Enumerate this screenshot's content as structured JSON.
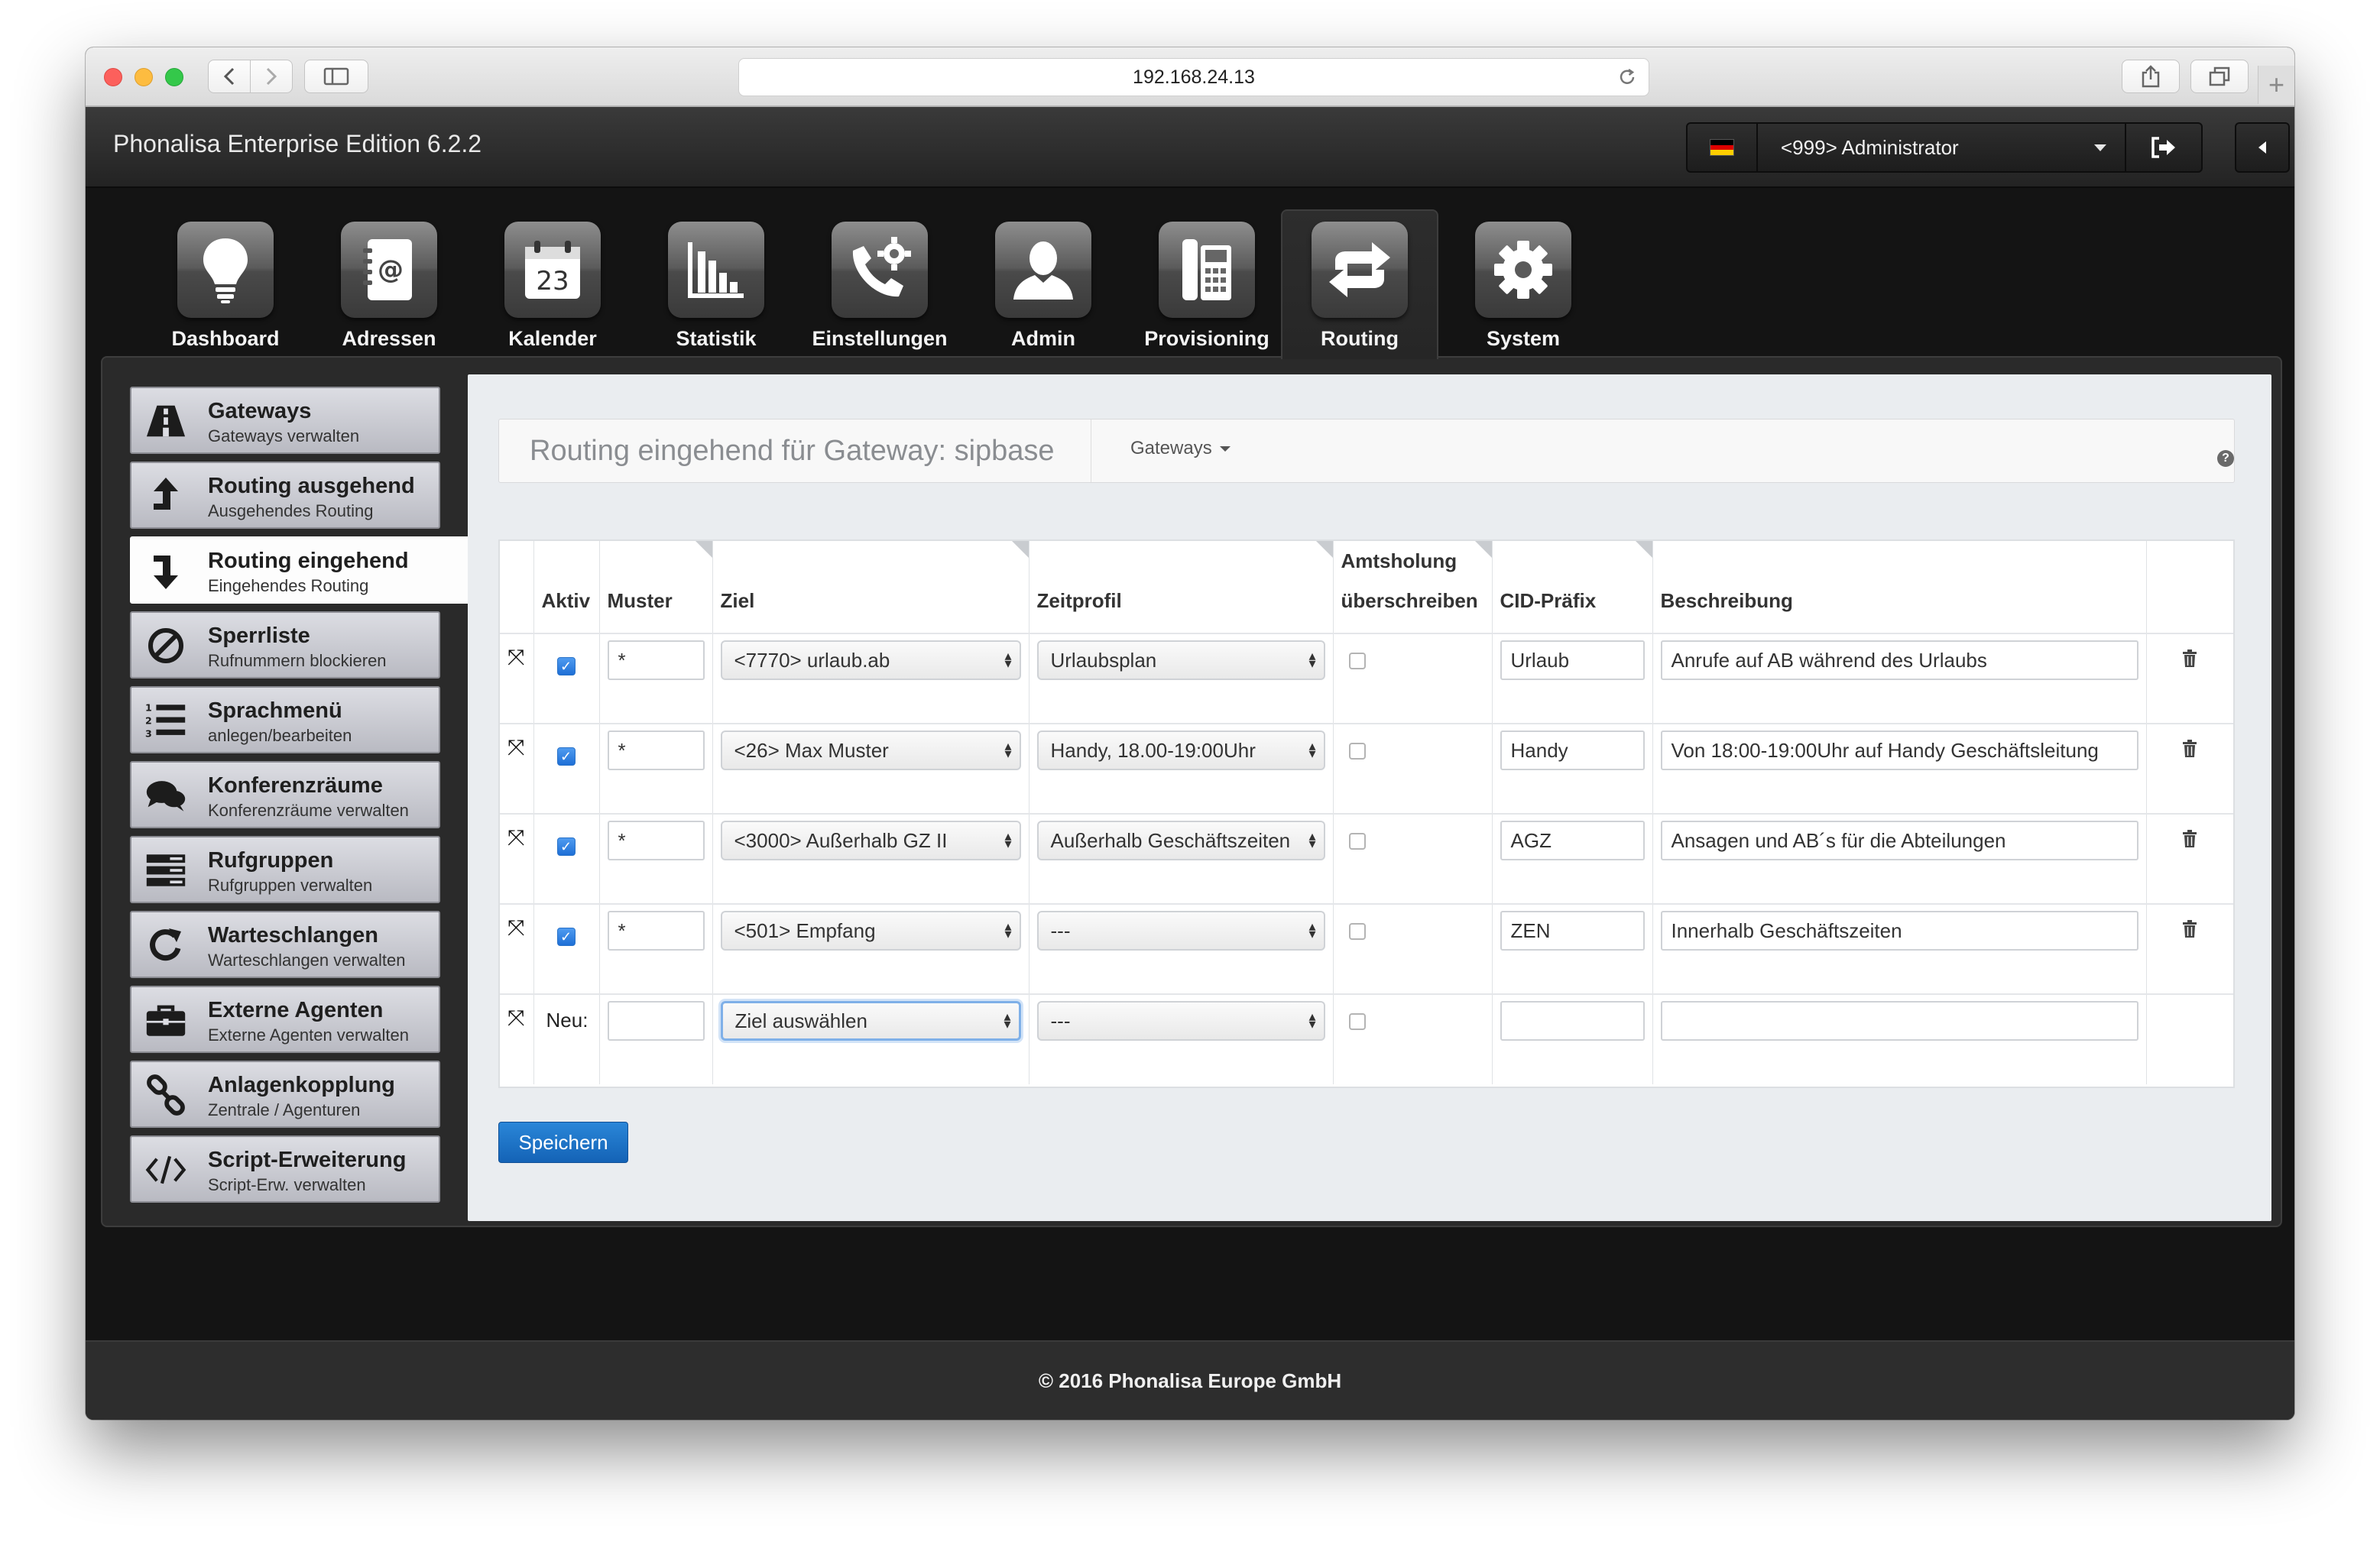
{
  "browser": {
    "url": "192.168.24.13"
  },
  "app": {
    "title": "Phonalisa Enterprise Edition 6.2.2",
    "user": "<999> Administrator",
    "flag_colors": [
      "#000000",
      "#dd0000",
      "#ffce00"
    ]
  },
  "nav": [
    {
      "label": "Dashboard",
      "icon": "lightbulb-icon"
    },
    {
      "label": "Adressen",
      "icon": "address-book-icon"
    },
    {
      "label": "Kalender",
      "icon": "calendar-icon"
    },
    {
      "label": "Statistik",
      "icon": "bar-chart-icon"
    },
    {
      "label": "Einstellungen",
      "icon": "phone-gear-icon"
    },
    {
      "label": "Admin",
      "icon": "user-icon"
    },
    {
      "label": "Provisioning",
      "icon": "desk-phone-icon"
    },
    {
      "label": "Routing",
      "icon": "routing-arrows-icon",
      "active": true
    },
    {
      "label": "System",
      "icon": "gear-icon"
    }
  ],
  "calendar_day": "23",
  "sidebar": [
    {
      "title": "Gateways",
      "sub": "Gateways verwalten",
      "icon": "road-icon"
    },
    {
      "title": "Routing ausgehend",
      "sub": "Ausgehendes Routing",
      "icon": "arrow-up-icon"
    },
    {
      "title": "Routing eingehend",
      "sub": "Eingehendes Routing",
      "icon": "arrow-down-icon",
      "active": true
    },
    {
      "title": "Sperrliste",
      "sub": "Rufnummern blockieren",
      "icon": "ban-icon"
    },
    {
      "title": "Sprachmenü",
      "sub": "anlegen/bearbeiten",
      "icon": "numbered-list-icon"
    },
    {
      "title": "Konferenzräume",
      "sub": "Konferenzräume verwalten",
      "icon": "chat-bubbles-icon"
    },
    {
      "title": "Rufgruppen",
      "sub": "Rufgruppen verwalten",
      "icon": "server-icon"
    },
    {
      "title": "Warteschlangen",
      "sub": "Warteschlangen verwalten",
      "icon": "refresh-icon"
    },
    {
      "title": "Externe Agenten",
      "sub": "Externe Agenten verwalten",
      "icon": "briefcase-icon"
    },
    {
      "title": "Anlagenkopplung",
      "sub": "Zentrale / Agenturen",
      "icon": "link-icon"
    },
    {
      "title": "Script-Erweiterung",
      "sub": "Script-Erw. verwalten",
      "icon": "code-icon"
    }
  ],
  "panel": {
    "title": "Routing eingehend für Gateway: sipbase",
    "gateways_dropdown": "Gateways",
    "help": "?"
  },
  "table": {
    "headers": {
      "aktiv": "Aktiv",
      "muster": "Muster",
      "ziel": "Ziel",
      "zeitprofil": "Zeitprofil",
      "amtsholung_1": "Amtsholung",
      "amtsholung_2": "überschreiben",
      "cid": "CID-Präfix",
      "beschreibung": "Beschreibung"
    },
    "rows": [
      {
        "muster": "*",
        "ziel": "<7770> urlaub.ab",
        "zeitprofil": "Urlaubsplan",
        "cid": "Urlaub",
        "beschreibung": "Anrufe auf AB während des Urlaubs"
      },
      {
        "muster": "*",
        "ziel": "<26> Max Muster",
        "zeitprofil": "Handy, 18.00-19:00Uhr",
        "cid": "Handy",
        "beschreibung": "Von 18:00-19:00Uhr auf Handy Geschäftsleitung"
      },
      {
        "muster": "*",
        "ziel": "<3000> Außerhalb GZ II",
        "zeitprofil": "Außerhalb Geschäftszeiten",
        "cid": "AGZ",
        "beschreibung": "Ansagen und AB´s für die Abteilungen"
      },
      {
        "muster": "*",
        "ziel": "<501> Empfang",
        "zeitprofil": "---",
        "cid": "ZEN",
        "beschreibung": "Innerhalb Geschäftszeiten"
      }
    ],
    "new_row": {
      "label": "Neu:",
      "ziel_placeholder": "Ziel auswählen",
      "zeitprofil": "---"
    }
  },
  "save_label": "Speichern",
  "footer": "© 2016 Phonalisa Europe GmbH"
}
